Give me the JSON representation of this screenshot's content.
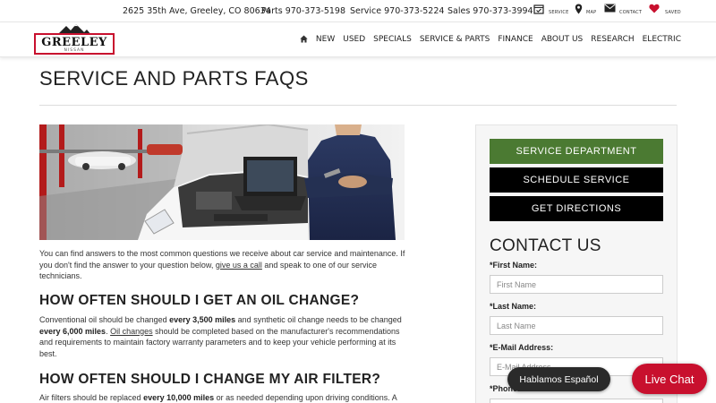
{
  "topbar": {
    "address": "2625 35th Ave, Greeley, CO 80634",
    "parts": "Parts 970-373-5198",
    "service": "Service 970-373-5224",
    "sales": "Sales 970-373-3994",
    "icons": [
      {
        "name": "calendar-check-icon",
        "label": "SERVICE"
      },
      {
        "name": "map-pin-icon",
        "label": "MAP"
      },
      {
        "name": "envelope-icon",
        "label": "CONTACT"
      },
      {
        "name": "heart-icon",
        "label": "SAVED",
        "color": "#c8102e"
      }
    ]
  },
  "header": {
    "logo_text": "GREELEY",
    "logo_sub": "NISSAN",
    "nav": [
      "NEW",
      "USED",
      "SPECIALS",
      "SERVICE & PARTS",
      "FINANCE",
      "ABOUT US",
      "RESEARCH",
      "ELECTRIC"
    ]
  },
  "page": {
    "title": "SERVICE AND PARTS FAQS",
    "intro_1": "You can find answers to the most common questions we receive about car service and maintenance. If you don't find the answer to your question below, ",
    "intro_link": "give us a call",
    "intro_2": " and speak to one of our service technicians.",
    "q1": "HOW OFTEN SHOULD I GET AN OIL CHANGE?",
    "a1_1": "Conventional oil should be changed ",
    "a1_b1": "every 3,500 miles",
    "a1_2": " and synthetic oil change needs to be changed ",
    "a1_b2": "every 6,000 miles",
    "a1_3": ". ",
    "a1_link": "Oil changes",
    "a1_4": " should be completed based on the manufacturer's recommendations and requirements to maintain factory warranty parameters and to keep your vehicle performing at its best.",
    "q2": "HOW OFTEN SHOULD I CHANGE MY AIR FILTER?",
    "a2_1": "Air filters should be replaced ",
    "a2_b1": "every 10,000 miles",
    "a2_2": " or as needed depending upon driving conditions. A"
  },
  "sidebar": {
    "btn_service": "SERVICE DEPARTMENT",
    "btn_schedule": "SCHEDULE SERVICE",
    "btn_directions": "GET DIRECTIONS",
    "contact_title": "CONTACT US",
    "first_label": "*First Name:",
    "first_placeholder": "First Name",
    "last_label": "*Last Name:",
    "last_placeholder": "Last Name",
    "email_label": "*E-Mail Address:",
    "email_placeholder": "E-Mail Address",
    "phone_label": "*Phone:"
  },
  "floating": {
    "spanish": "Hablamos Español",
    "chat": "Live Chat"
  },
  "colors": {
    "brand_red": "#c8102e",
    "service_green": "#4b7a32"
  }
}
